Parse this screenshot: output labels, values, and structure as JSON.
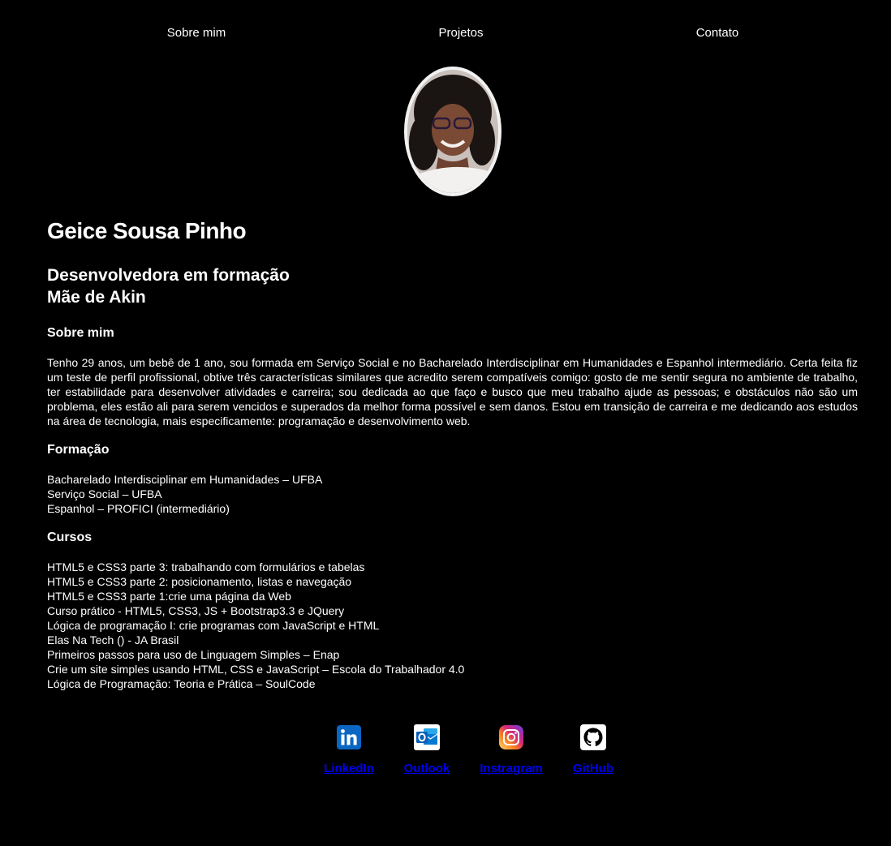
{
  "nav": {
    "items": [
      {
        "label": "Sobre mim"
      },
      {
        "label": "Projetos"
      },
      {
        "label": "Contato"
      }
    ]
  },
  "profile": {
    "name": "Geice Sousa Pinho",
    "subtitle_line1": "Desenvolvedora em formação",
    "subtitle_line2": "Mãe de Akin"
  },
  "about": {
    "title": "Sobre mim",
    "text": "Tenho 29 anos, um bebê de 1 ano, sou formada em Serviço Social e no Bacharelado Interdisciplinar em Humanidades e Espanhol intermediário. Certa feita fiz um teste de perfil profissional, obtive três características similares que acredito serem compatíveis comigo: gosto de me sentir segura no ambiente de trabalho, ter estabilidade para desenvolver atividades e carreira; sou dedicada ao que faço e busco que meu trabalho ajude as pessoas; e obstáculos não são um problema, eles estão ali para serem vencidos e superados da melhor forma possível e sem danos. Estou em transição de carreira e me dedicando aos estudos na área de tecnologia, mais especificamente: programação e desenvolvimento web."
  },
  "education": {
    "title": "Formação",
    "items": [
      "Bacharelado Interdisciplinar em Humanidades – UFBA",
      "Serviço Social – UFBA",
      "Espanhol – PROFICI (intermediário)"
    ]
  },
  "courses": {
    "title": "Cursos",
    "items": [
      "HTML5 e CSS3 parte 3: trabalhando com formulários e tabelas",
      "HTML5 e CSS3 parte 2: posicionamento, listas e navegação",
      "HTML5 e CSS3 parte 1:crie uma página da Web",
      "Curso prático - HTML5, CSS3, JS + Bootstrap3.3 e JQuery",
      "Lógica de programação I: crie programas com JavaScript e HTML",
      "Elas Na Tech () - JA Brasil",
      "Primeiros passos para uso de Linguagem Simples – Enap",
      "Crie um site simples usando HTML, CSS e JavaScript – Escola do Trabalhador 4.0",
      "Lógica de Programação: Teoria e Prática – SoulCode"
    ]
  },
  "social": {
    "items": [
      {
        "label": "LinkedIn",
        "icon": "linkedin-icon"
      },
      {
        "label": "Outlook",
        "icon": "outlook-icon"
      },
      {
        "label": "Instragram",
        "icon": "instagram-icon"
      },
      {
        "label": "GitHub",
        "icon": "github-icon"
      }
    ]
  },
  "colors": {
    "background": "#000000",
    "text": "#ffffff",
    "linkedin": "#0a66c2",
    "outlook": "#0078d4"
  }
}
